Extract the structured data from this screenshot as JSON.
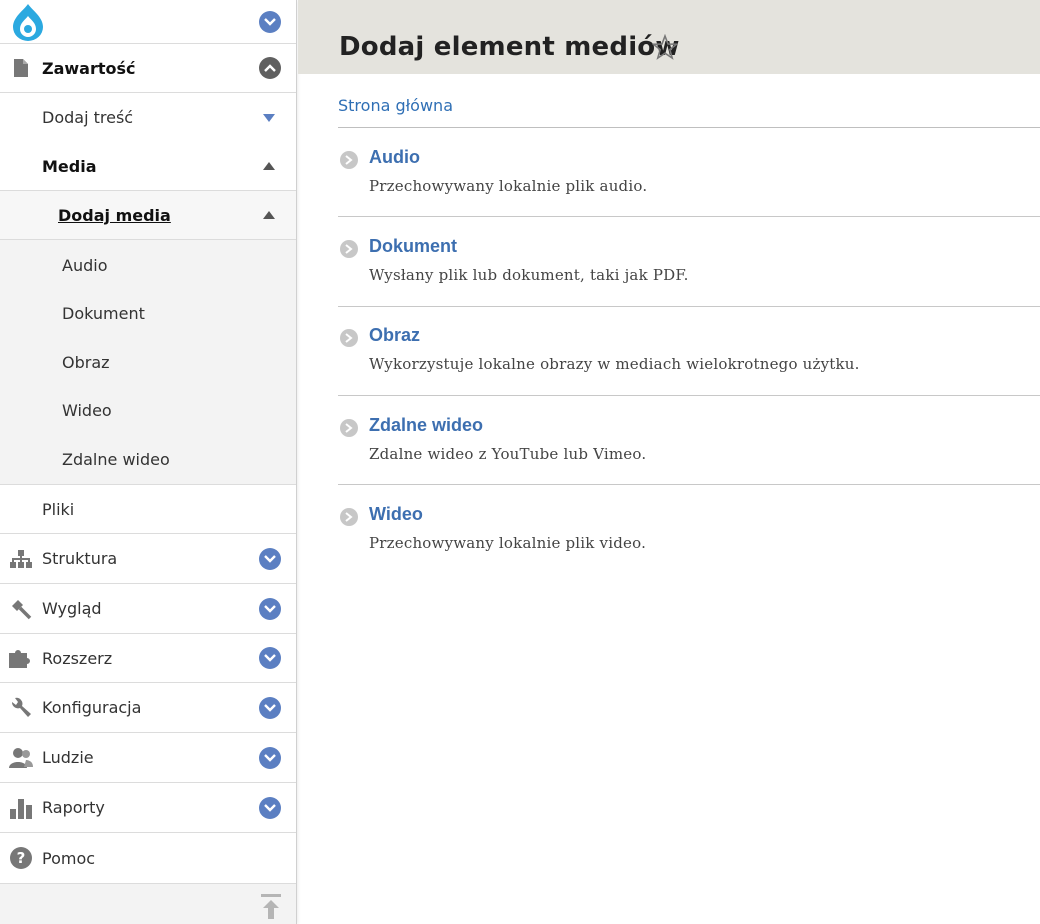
{
  "sidebar": {
    "logo_icon": "drupal-drop-icon",
    "menu": {
      "zawartosc": "Zawartość",
      "dodaj_tresc": "Dodaj treść",
      "media": "Media",
      "dodaj_media": "Dodaj media",
      "sub_items": [
        "Audio",
        "Dokument",
        "Obraz",
        "Wideo",
        "Zdalne wideo"
      ],
      "pliki": "Pliki",
      "struktura": "Struktura",
      "wyglad": "Wygląd",
      "rozszerz": "Rozszerz",
      "konfiguracja": "Konfiguracja",
      "ludzie": "Ludzie",
      "raporty": "Raporty",
      "pomoc": "Pomoc"
    },
    "accent": "#5b7fc2"
  },
  "page": {
    "title": "Dodaj element mediów",
    "breadcrumb": "Strona główna",
    "entries": [
      {
        "title": "Audio",
        "desc": "Przechowywany lokalnie plik audio."
      },
      {
        "title": "Dokument",
        "desc": "Wysłany plik lub dokument, taki jak PDF."
      },
      {
        "title": "Obraz",
        "desc": "Wykorzystuje lokalne obrazy w mediach wielokrotnego użytku."
      },
      {
        "title": "Zdalne wideo",
        "desc": "Zdalne wideo z YouTube lub Vimeo."
      },
      {
        "title": "Wideo",
        "desc": "Przechowywany lokalnie plik video."
      }
    ]
  },
  "colors": {
    "header_band": "#e4e3dd",
    "link": "#3d6fb0"
  }
}
